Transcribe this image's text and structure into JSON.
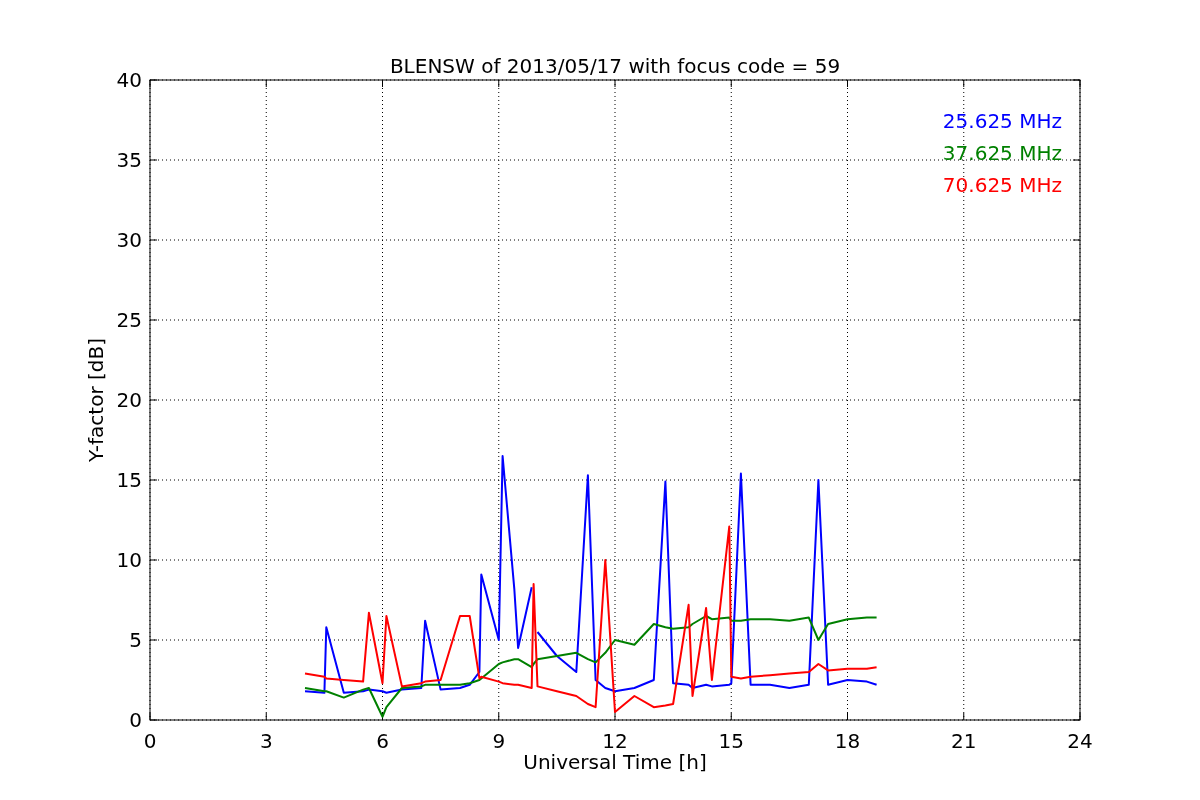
{
  "chart_data": {
    "type": "line",
    "title": "BLENSW of 2013/05/17 with focus code = 59",
    "xlabel": "Universal Time [h]",
    "ylabel": "Y-factor [dB]",
    "x": [
      4.0,
      4.5,
      4.55,
      5.0,
      5.5,
      5.65,
      6.0,
      6.1,
      6.5,
      7.0,
      7.1,
      7.5,
      8.0,
      8.25,
      8.5,
      8.55,
      9.0,
      9.1,
      9.4,
      9.5,
      9.85,
      9.9,
      10.0,
      10.5,
      11.0,
      11.3,
      11.5,
      11.75,
      12.0,
      12.5,
      13.0,
      13.3,
      13.5,
      13.9,
      14.0,
      14.35,
      14.5,
      14.95,
      15.0,
      15.25,
      15.5,
      16.0,
      16.5,
      17.0,
      17.25,
      17.5,
      18.0,
      18.5,
      18.75
    ],
    "series": [
      {
        "name": "25.625 MHz",
        "color": "#0000ff",
        "values": [
          1.8,
          1.7,
          5.8,
          1.7,
          1.8,
          1.9,
          1.8,
          1.7,
          1.9,
          2.0,
          6.2,
          1.9,
          2.0,
          2.2,
          3.0,
          9.1,
          5.0,
          16.5,
          8.2,
          4.5,
          8.3,
          null,
          5.5,
          4.0,
          3.0,
          15.3,
          2.5,
          2.0,
          1.8,
          2.0,
          2.5,
          14.9,
          2.3,
          2.2,
          2.0,
          2.2,
          2.1,
          2.2,
          2.3,
          15.4,
          2.2,
          2.2,
          2.0,
          2.2,
          15.0,
          2.2,
          2.5,
          2.4,
          2.2
        ]
      },
      {
        "name": "37.625 MHz",
        "color": "#008000",
        "values": [
          2.0,
          1.8,
          1.8,
          1.4,
          1.9,
          2.0,
          0.2,
          0.8,
          2.0,
          2.1,
          2.2,
          2.2,
          2.2,
          2.3,
          2.5,
          2.6,
          3.5,
          3.6,
          3.8,
          3.8,
          3.3,
          3.5,
          3.8,
          4.0,
          4.2,
          3.8,
          3.6,
          4.2,
          5.0,
          4.7,
          6.0,
          5.8,
          5.7,
          5.8,
          6.0,
          6.5,
          6.3,
          6.4,
          6.2,
          6.2,
          6.3,
          6.3,
          6.2,
          6.4,
          5.0,
          6.0,
          6.3,
          6.4,
          6.4
        ]
      },
      {
        "name": "70.625 MHz",
        "color": "#ff0000",
        "values": [
          2.9,
          2.7,
          2.6,
          2.5,
          2.4,
          6.7,
          2.3,
          6.5,
          2.1,
          2.3,
          2.4,
          2.5,
          6.5,
          6.5,
          2.6,
          2.7,
          2.4,
          2.3,
          2.2,
          2.2,
          2.0,
          8.5,
          2.1,
          1.8,
          1.5,
          1.0,
          0.8,
          10.0,
          0.5,
          1.5,
          0.8,
          0.9,
          1.0,
          7.2,
          1.5,
          7.0,
          2.5,
          12.1,
          2.7,
          2.6,
          2.7,
          2.8,
          2.9,
          3.0,
          3.5,
          3.1,
          3.2,
          3.2,
          3.3
        ]
      }
    ],
    "grid": true,
    "xlim": [
      0,
      24
    ],
    "ylim": [
      0,
      40
    ],
    "xticks": [
      0,
      3,
      6,
      9,
      12,
      15,
      18,
      21,
      24
    ],
    "yticks": [
      0,
      5,
      10,
      15,
      20,
      25,
      30,
      35,
      40
    ]
  }
}
